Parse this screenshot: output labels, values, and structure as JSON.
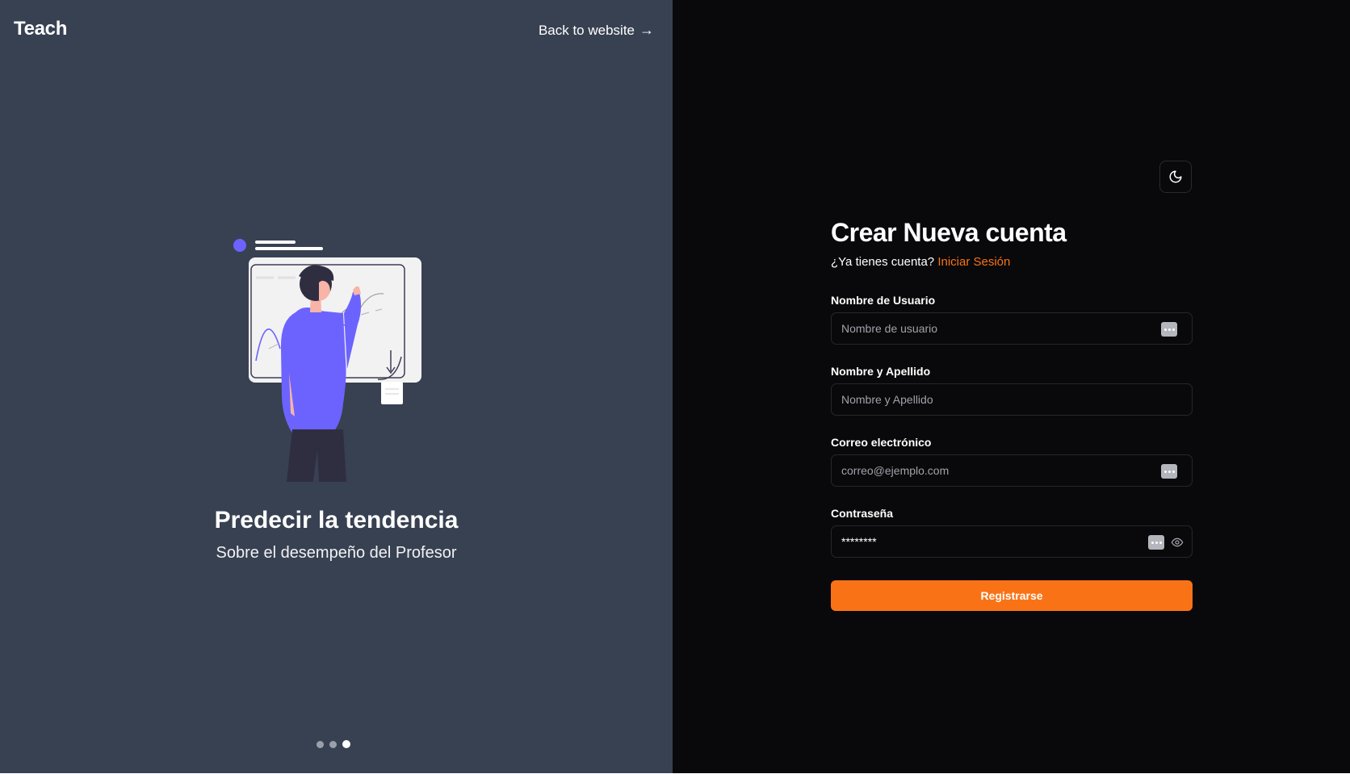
{
  "header": {
    "brand": "Teach",
    "back_link": "Back to website",
    "back_arrow": "→"
  },
  "slide": {
    "title": "Predecir la tendencia",
    "subtitle": "Sobre el desempeño del Profesor",
    "dots": 3,
    "active_dot": 3
  },
  "form": {
    "title": "Crear Nueva cuenta",
    "prompt": "¿Ya tienes cuenta?",
    "login_link": "Iniciar Sesión",
    "fields": [
      {
        "label": "Nombre de Usuario",
        "placeholder": "Nombre de usuario"
      },
      {
        "label": "Nombre y Apellido",
        "placeholder": "Nombre y Apellido"
      },
      {
        "label": "Correo electrónico",
        "placeholder": "correo@ejemplo.com"
      },
      {
        "label": "Contraseña",
        "value": "********"
      }
    ],
    "submit": "Registrarse"
  },
  "icons": {
    "theme_toggle": "moon-icon",
    "password_toggle": "eye-icon",
    "autofill": "password-manager-icon"
  },
  "colors": {
    "left_panel": "#384152",
    "right_panel": "#09090b",
    "accent": "#f97316",
    "illustration": "#6c63ff"
  }
}
